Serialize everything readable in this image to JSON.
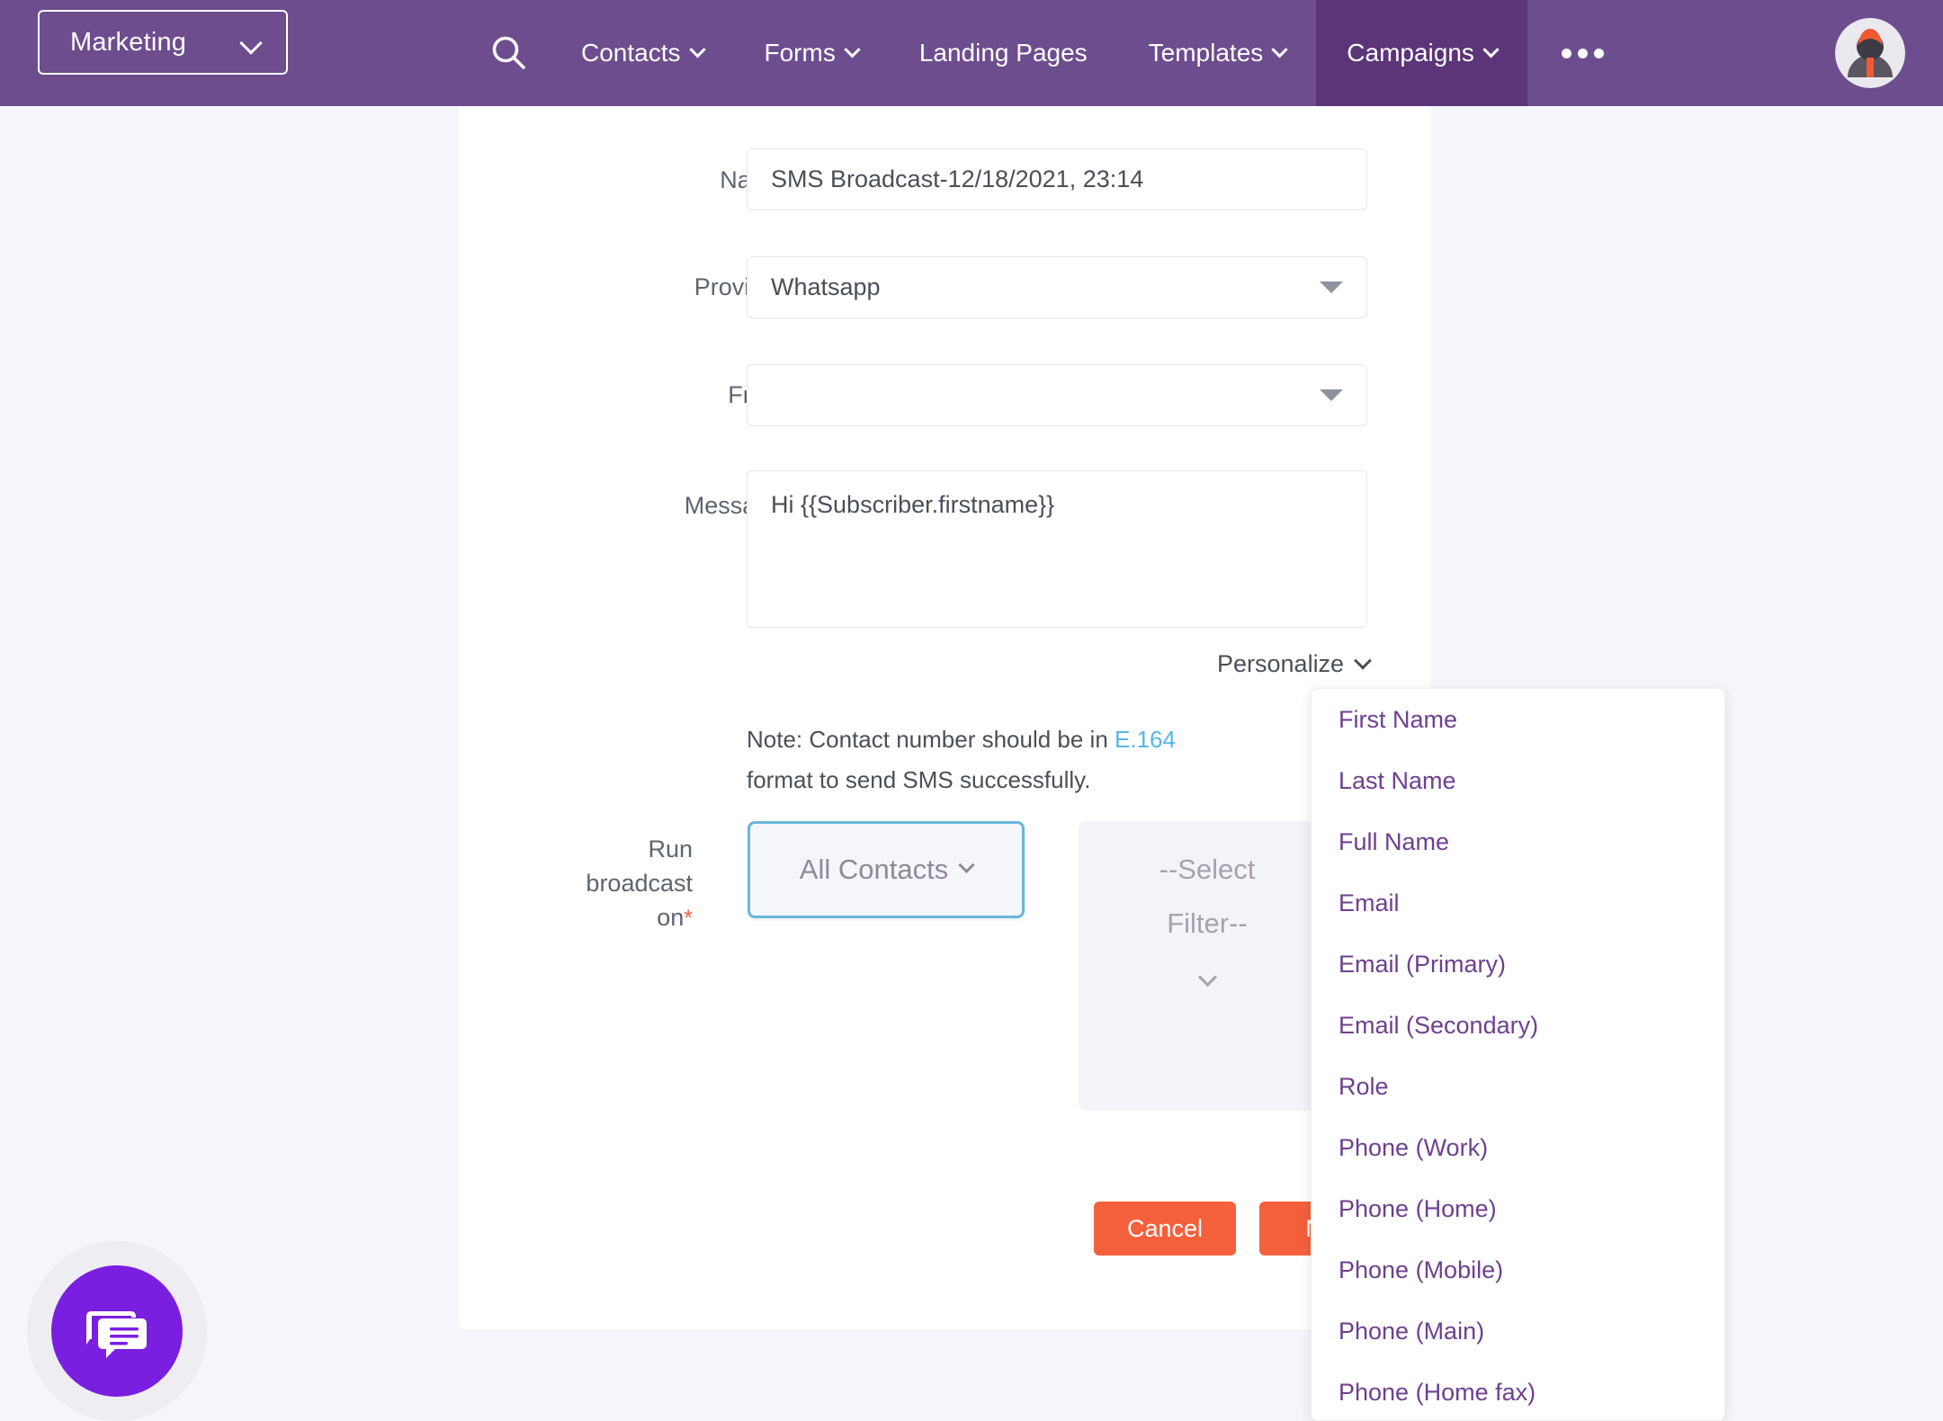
{
  "navbar": {
    "brand": "Marketing",
    "brand_icon": "chevron-down-icon",
    "search_icon": "search-icon",
    "items": [
      {
        "label": "Contacts",
        "has_caret": true,
        "active": false
      },
      {
        "label": "Forms",
        "has_caret": true,
        "active": false
      },
      {
        "label": "Landing Pages",
        "has_caret": false,
        "active": false
      },
      {
        "label": "Templates",
        "has_caret": true,
        "active": false
      },
      {
        "label": "Campaigns",
        "has_caret": true,
        "active": true
      }
    ],
    "more_icon": "ellipsis-icon",
    "avatar_icon": "user-avatar",
    "bg_color": "#6d4d8e",
    "active_bg_color": "#5b3578"
  },
  "form": {
    "name": {
      "label": "Name",
      "required_mark": "*",
      "value": "SMS Broadcast-12/18/2021, 23:14",
      "placeholder": ""
    },
    "provider": {
      "label": "Provider",
      "required_mark": "*",
      "value": "Whatsapp",
      "caret_icon": "triangle-down-icon"
    },
    "from": {
      "label": "From",
      "required_mark": "*",
      "value": "",
      "caret_icon": "triangle-down-icon"
    },
    "message": {
      "label": "Message",
      "required_mark": "*",
      "value": "Hi {{Subscriber.firstname}}"
    },
    "personalize": {
      "label": "Personalize",
      "caret_icon": "chevron-down-icon"
    },
    "note": {
      "prefix": "Note: Contact number should be in ",
      "link": "E.164",
      "suffix": " format to send SMS successfully.",
      "link_color": "#57b6e5"
    },
    "run_broadcast": {
      "label_line1": "Run broadcast",
      "label_line2": "on",
      "required_mark": "*",
      "all_contacts": {
        "label": "All Contacts",
        "caret_icon": "chevron-down-icon",
        "focus_border_color": "#6ab6dc"
      },
      "select_filter": {
        "line1": "--Select",
        "line2": "Filter--",
        "caret_icon": "chevron-down-icon",
        "disabled": true
      }
    }
  },
  "footer": {
    "cancel_label": "Cancel",
    "next_label": "Next",
    "button_color": "#f4603c"
  },
  "personalize_dropdown": {
    "items": [
      "First Name",
      "Last Name",
      "Full Name",
      "Email",
      "Email (Primary)",
      "Email (Secondary)",
      "Role",
      "Phone (Work)",
      "Phone (Home)",
      "Phone (Mobile)",
      "Phone (Main)",
      "Phone (Home fax)"
    ],
    "text_color": "#6e4090"
  },
  "chat_widget": {
    "icon": "chat-bubble-icon",
    "color": "#7a1fe0"
  }
}
